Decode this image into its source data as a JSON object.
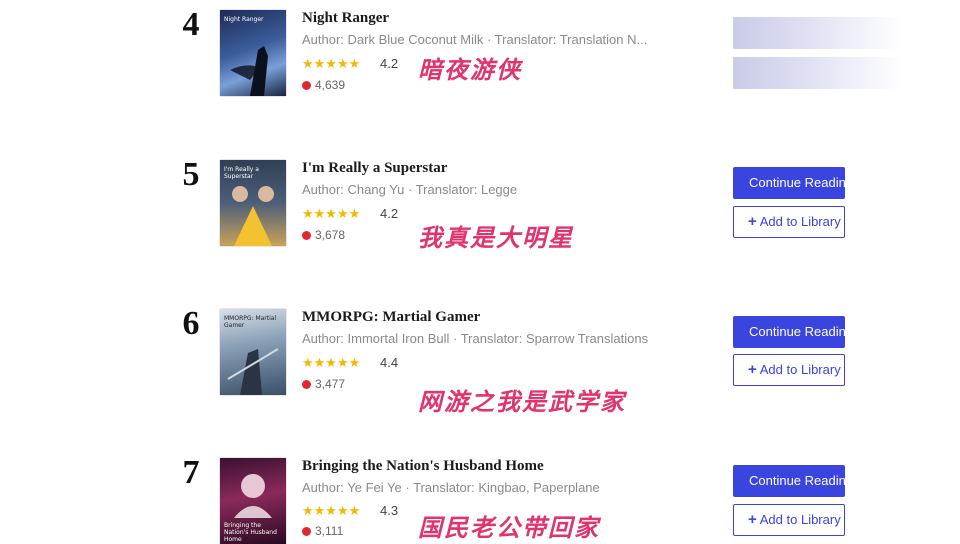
{
  "rows": [
    {
      "rank": "4",
      "title": "Night Ranger",
      "meta": "Author: Dark Blue Coconut Milk · Translator: Translation N...",
      "stars": "★★★★★",
      "score": "4.2",
      "readers": "4,639",
      "chinese_title": "暗夜游侠",
      "cover_text": "Night Ranger",
      "buttons_visible": false
    },
    {
      "rank": "5",
      "title": "I'm Really a Superstar",
      "meta": "Author: Chang Yu · Translator: Legge",
      "stars": "★★★★★",
      "score": "4.2",
      "readers": "3,678",
      "chinese_title": "我真是大明星",
      "cover_text": "I'm Really a Superstar",
      "continue_label": "Continue Reading",
      "add_label": "Add to Library",
      "buttons_visible": true
    },
    {
      "rank": "6",
      "title": "MMORPG: Martial Gamer",
      "meta": "Author: Immortal Iron Bull · Translator: Sparrow Translations",
      "stars": "★★★★★",
      "score": "4.4",
      "readers": "3,477",
      "chinese_title": "网游之我是武学家",
      "cover_text": "MMORPG: Martial Gamer",
      "continue_label": "Continue Reading",
      "add_label": "Add to Library",
      "buttons_visible": true
    },
    {
      "rank": "7",
      "title": "Bringing the Nation's Husband Home",
      "meta": "Author: Ye Fei Ye · Translator: Kingbao, Paperplane",
      "stars": "★★★★★",
      "score": "4.3",
      "readers": "3,111",
      "chinese_title": "国民老公带回家",
      "cover_text": "Bringing the Nation's Husband Home",
      "continue_label": "Continue Reading",
      "add_label": "Add to Library",
      "buttons_visible": true
    }
  ],
  "colors": {
    "primary_button": "#3a44df",
    "star": "#f4b800",
    "reader_dot": "#e0282e",
    "chinese_caption": "#e0336f"
  },
  "icons": {
    "star": "star-icon",
    "reader": "fire-dot-icon",
    "add": "plus-icon"
  }
}
